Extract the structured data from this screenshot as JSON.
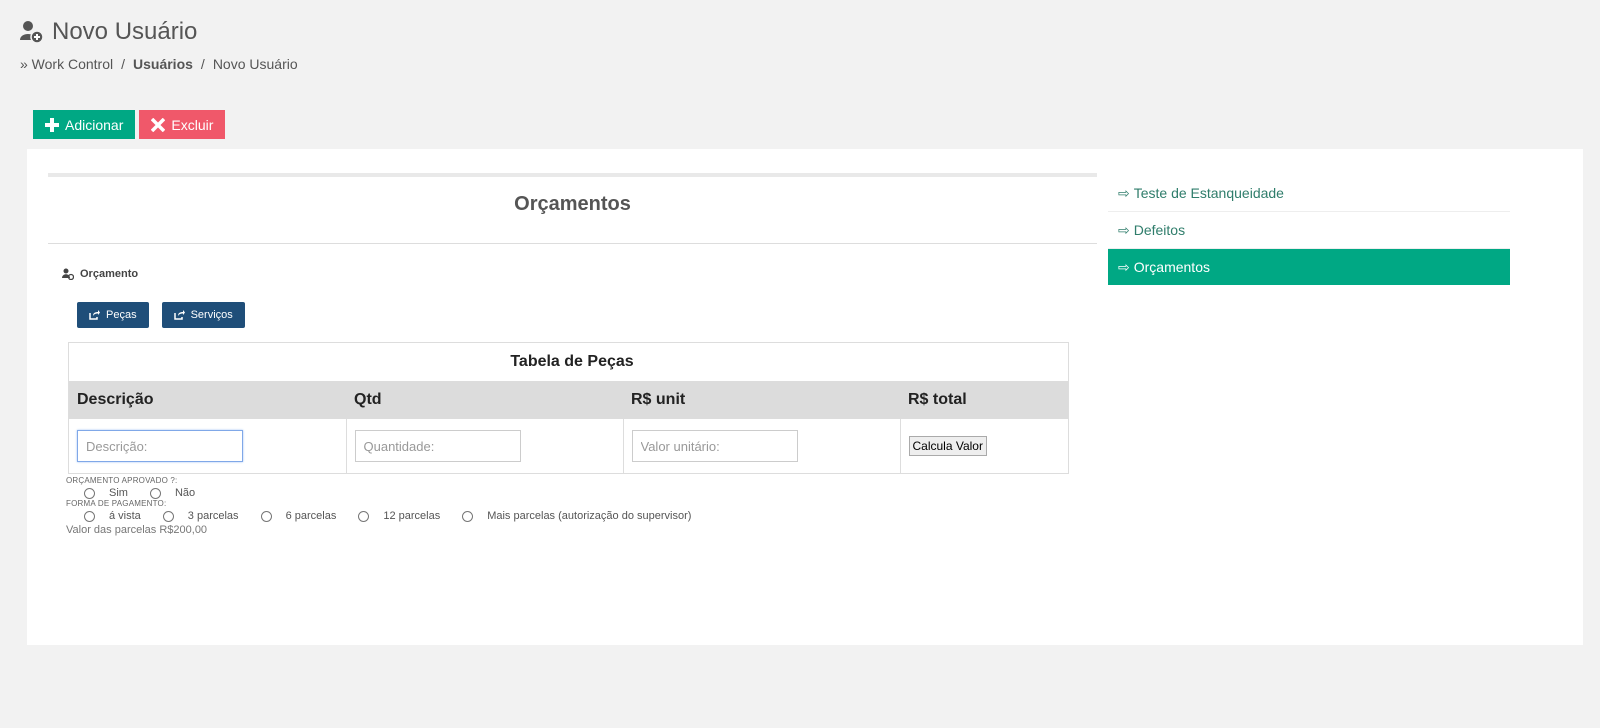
{
  "header": {
    "title": "Novo Usuário",
    "breadcrumb": {
      "prefix": "» Work Control",
      "sep": "/",
      "level2": "Usuários",
      "level3": "Novo Usuário"
    }
  },
  "actions": {
    "add_label": "Adicionar",
    "delete_label": "Excluir"
  },
  "main": {
    "section_title": "Orçamentos",
    "orcamento_label": "Orçamento",
    "sub_buttons": [
      "Peças",
      "Serviços"
    ],
    "table": {
      "caption": "Tabela de Peças",
      "headers": [
        "Descrição",
        "Qtd",
        "R$ unit",
        "R$ total"
      ],
      "placeholders": {
        "descricao": "Descrição:",
        "quantidade": "Quantidade:",
        "valor_unitario": "Valor unitário:"
      },
      "calc_button": "Calcula Valor"
    },
    "approval": {
      "label": "ORÇAMENTO APROVADO ?:",
      "options": [
        "Sim",
        "Não"
      ]
    },
    "payment": {
      "label": "FORMA DE PAGAMENTO:",
      "options": [
        "á vista",
        "3 parcelas",
        "6 parcelas",
        "12 parcelas",
        "Mais parcelas (autorização do supervisor)"
      ]
    },
    "installment_value": "Valor das parcelas R$200,00"
  },
  "sidenav": {
    "items": [
      {
        "label": "Teste de Estanqueidade",
        "active": false
      },
      {
        "label": "Defeitos",
        "active": false
      },
      {
        "label": "Orçamentos",
        "active": true
      }
    ],
    "arrow": "⇨"
  },
  "colors": {
    "accent": "#00a884",
    "danger": "#f0586a",
    "navy": "#1f4e79"
  },
  "icons": {
    "title": "user-plus-icon",
    "add": "plus-icon",
    "delete": "x-icon",
    "sub": "share-icon",
    "orcamento": "user-cog-icon"
  }
}
